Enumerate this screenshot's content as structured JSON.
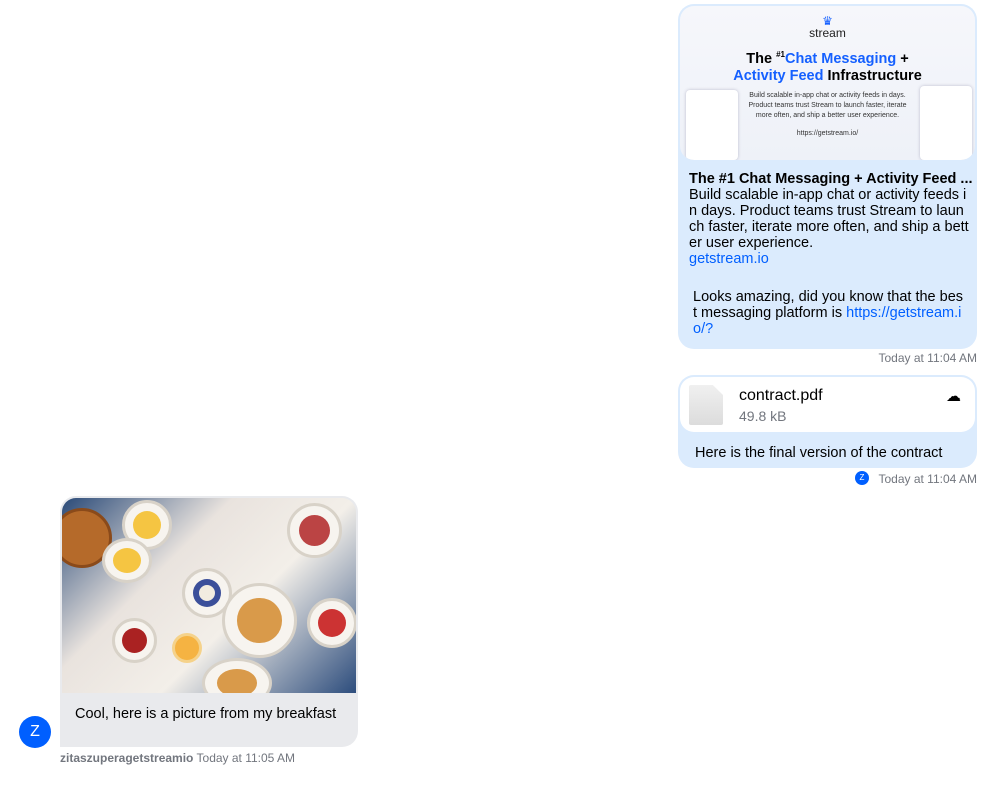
{
  "messages": [
    {
      "side": "right",
      "preview": {
        "logo_text": "stream",
        "headline_1": "The ",
        "headline_num": "#1",
        "headline_blue": "Chat Messaging",
        "headline_plus": " +",
        "headline_blue2": "Activity Feed",
        "headline_end": " Infrastructure",
        "sub_1": "Build scalable in-app chat or activity feeds in days.",
        "sub_2": "Product teams trust Stream to launch faster, iterate",
        "sub_3": "more often, and ship a better user experience.",
        "url": "https://getstream.io/"
      },
      "link_title": "The #1 Chat Messaging + Activity Feed ...",
      "link_desc": "Build scalable in-app chat or activity feeds in days. Product teams trust Stream to launch faster, iterate more often, and ship a better user experience.",
      "link_domain": "getstream.io",
      "text": "Looks amazing, did you know that the best messaging platform is ",
      "text_link": "https://getstream.io/?",
      "timestamp": "Today at 11:04 AM"
    },
    {
      "side": "right",
      "file": {
        "name": "contract.pdf",
        "size": "49.8 kB",
        "icon": "file-icon",
        "action_icon": "cloud-download-icon"
      },
      "text": "Here is the final version of the contract",
      "read_avatar": "Z",
      "timestamp": "Today at 11:04 AM"
    },
    {
      "side": "left",
      "avatar": "Z",
      "image": "breakfast-photo",
      "text": "Cool, here is a picture from my breakfast",
      "author": "zitaszuperagetstreamio",
      "timestamp": "Today at 11:05 AM"
    }
  ],
  "colors": {
    "own_bubble": "#dbebfd",
    "other_bubble": "#e9eaed",
    "accent": "#005fff"
  }
}
